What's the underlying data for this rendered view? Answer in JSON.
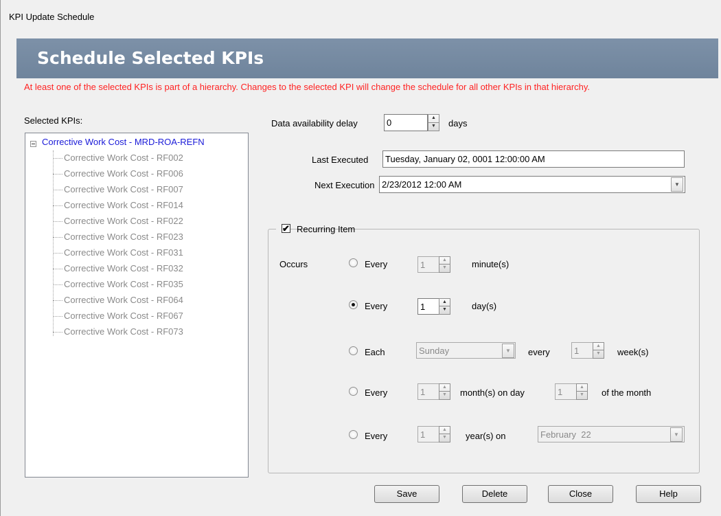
{
  "window": {
    "title": "KPI Update Schedule"
  },
  "banner": {
    "title": "Schedule Selected KPIs"
  },
  "warning": "At least one of the selected KPIs is part of a hierarchy. Changes to the selected KPI will change the schedule for all other KPIs in that hierarchy.",
  "selected_kpis": {
    "label": "Selected KPIs:",
    "root": "Corrective Work Cost - MRD-ROA-REFN",
    "children": [
      "Corrective Work Cost - RF002",
      "Corrective Work Cost - RF006",
      "Corrective Work Cost - RF007",
      "Corrective Work Cost - RF014",
      "Corrective Work Cost - RF022",
      "Corrective Work Cost - RF023",
      "Corrective Work Cost - RF031",
      "Corrective Work Cost - RF032",
      "Corrective Work Cost - RF035",
      "Corrective Work Cost - RF064",
      "Corrective Work Cost - RF067",
      "Corrective Work Cost - RF073"
    ]
  },
  "delay": {
    "label": "Data availability delay",
    "value": "0",
    "unit": "days"
  },
  "last_executed": {
    "label": "Last Executed",
    "value": "Tuesday, January 02, 0001 12:00:00 AM"
  },
  "next_execution": {
    "label": "Next Execution",
    "value": "2/23/2012 12:00 AM"
  },
  "recurring": {
    "label": "Recurring Item",
    "checked": true,
    "occurs_label": "Occurs",
    "minute": {
      "radio": "Every",
      "value": "1",
      "unit": "minute(s)"
    },
    "day": {
      "radio": "Every",
      "value": "1",
      "unit": "day(s)"
    },
    "week": {
      "radio": "Each",
      "weekday": "Sunday",
      "every": "every",
      "value": "1",
      "unit": "week(s)"
    },
    "month": {
      "radio": "Every",
      "value": "1",
      "unit": "month(s) on day",
      "day_value": "1",
      "suffix": "of the month"
    },
    "year": {
      "radio": "Every",
      "value": "1",
      "unit": "year(s) on",
      "date": "February  22"
    }
  },
  "buttons": {
    "save": "Save",
    "delete": "Delete",
    "close": "Close",
    "help": "Help"
  }
}
